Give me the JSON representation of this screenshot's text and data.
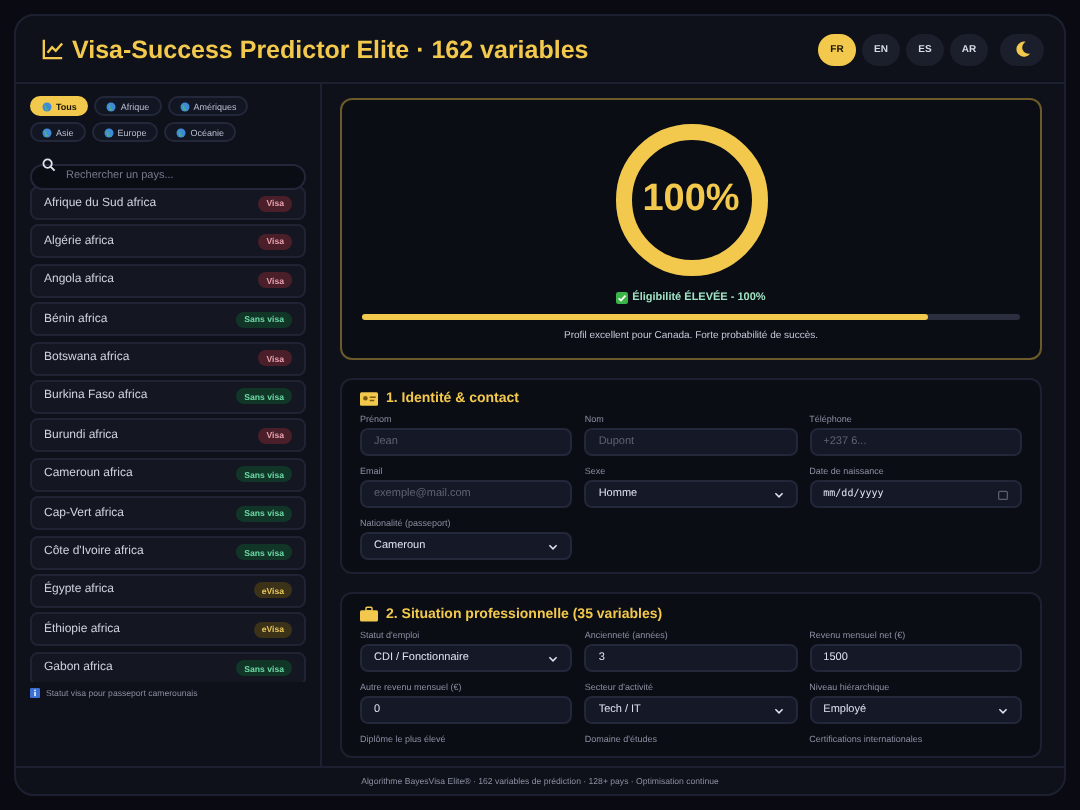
{
  "header": {
    "title": "Visa-Success Predictor Elite · 162 variables",
    "languages": [
      {
        "label": "FR",
        "selected": true
      },
      {
        "label": "EN",
        "selected": false
      },
      {
        "label": "ES",
        "selected": false
      },
      {
        "label": "AR",
        "selected": false
      }
    ]
  },
  "sidebar": {
    "regions": [
      {
        "label": "Tous",
        "selected": true
      },
      {
        "label": "Afrique",
        "selected": false
      },
      {
        "label": "Amériques",
        "selected": false
      },
      {
        "label": "Asie",
        "selected": false
      },
      {
        "label": "Europe",
        "selected": false
      },
      {
        "label": "Océanie",
        "selected": false
      }
    ],
    "search": {
      "placeholder": "Rechercher un pays..."
    },
    "countries": [
      {
        "name": "Afrique du Sud africa",
        "status": "Visa",
        "kind": "visa"
      },
      {
        "name": "Algérie africa",
        "status": "Visa",
        "kind": "visa"
      },
      {
        "name": "Angola africa",
        "status": "Visa",
        "kind": "visa"
      },
      {
        "name": "Bénin africa",
        "status": "Sans visa",
        "kind": "free"
      },
      {
        "name": "Botswana africa",
        "status": "Visa",
        "kind": "visa"
      },
      {
        "name": "Burkina Faso africa",
        "status": "Sans visa",
        "kind": "free"
      },
      {
        "name": "Burundi africa",
        "status": "Visa",
        "kind": "visa"
      },
      {
        "name": "Cameroun africa",
        "status": "Sans visa",
        "kind": "free"
      },
      {
        "name": "Cap-Vert africa",
        "status": "Sans visa",
        "kind": "free"
      },
      {
        "name": "Côte d'Ivoire africa",
        "status": "Sans visa",
        "kind": "free"
      },
      {
        "name": "Égypte africa",
        "status": "eVisa",
        "kind": "evisa"
      },
      {
        "name": "Éthiopie africa",
        "status": "eVisa",
        "kind": "evisa"
      },
      {
        "name": "Gabon africa",
        "status": "Sans visa",
        "kind": "free"
      }
    ],
    "note": "Statut visa pour passeport camerounais"
  },
  "result": {
    "score": "100%",
    "gauge": {
      "level": 1
    },
    "eligibility": "Éligibilité ÉLEVÉE - 100%",
    "progress": {
      "level": 0.86
    },
    "message": "Profil excellent pour Canada. Forte probabilité de succès."
  },
  "sections": [
    {
      "title": "1. Identité & contact",
      "kind": "identity",
      "fields": [
        {
          "label": "Prénom",
          "kind": "text",
          "placeholder": "Jean"
        },
        {
          "label": "Nom",
          "kind": "text",
          "placeholder": "Dupont"
        },
        {
          "label": "Téléphone",
          "kind": "text",
          "placeholder": "+237 6..."
        },
        {
          "label": "Email",
          "kind": "text",
          "placeholder": "exemple@mail.com"
        },
        {
          "label": "Sexe",
          "kind": "select",
          "value": "Homme"
        },
        {
          "label": "Date de naissance",
          "kind": "date",
          "value": "mm/dd/yyyy"
        },
        {
          "label": "Nationalité (passeport)",
          "kind": "select",
          "value": "Cameroun"
        }
      ]
    },
    {
      "title": "2. Situation professionnelle (35 variables)",
      "kind": "work",
      "fields": [
        {
          "label": "Statut d'emploi",
          "kind": "select",
          "value": "CDI / Fonctionnaire"
        },
        {
          "label": "Ancienneté (années)",
          "kind": "text",
          "value": "3"
        },
        {
          "label": "Revenu mensuel net (€)",
          "kind": "text",
          "value": "1500"
        },
        {
          "label": "Autre revenu mensuel (€)",
          "kind": "text",
          "value": "0"
        },
        {
          "label": "Secteur d'activité",
          "kind": "select",
          "value": "Tech / IT"
        },
        {
          "label": "Niveau hiérarchique",
          "kind": "select",
          "value": "Employé"
        },
        {
          "label": "Diplôme le plus élevé",
          "kind": "label"
        },
        {
          "label": "Domaine d'études",
          "kind": "label"
        },
        {
          "label": "Certifications internationales",
          "kind": "label"
        }
      ]
    }
  ],
  "footer": "Algorithme BayesVisa Elite® · 162 variables de prédiction · 128+ pays · Optimisation continue"
}
